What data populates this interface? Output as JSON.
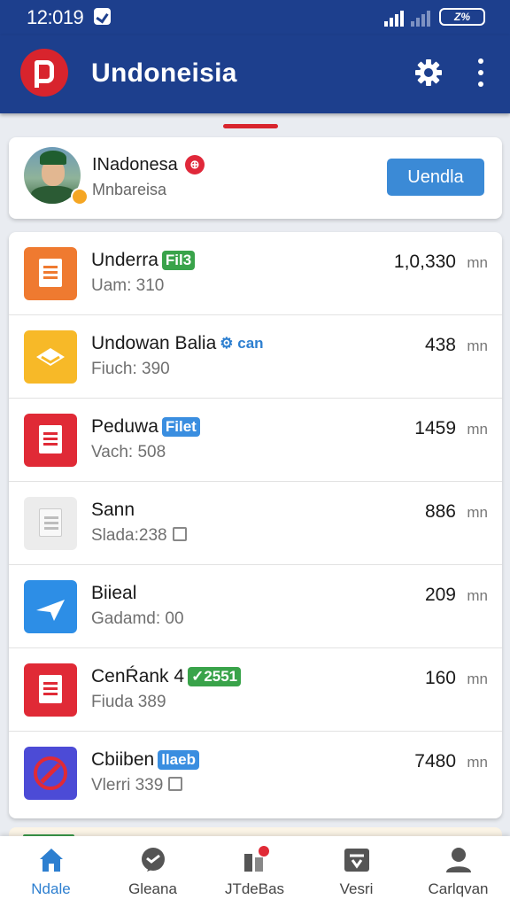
{
  "status": {
    "time": "12:019",
    "battery": "Z%"
  },
  "appbar": {
    "title": "Undoneisia",
    "settings_icon": "gear-icon",
    "more_icon": "more-vert-icon"
  },
  "profile": {
    "name": "INadonesa",
    "flag_glyph": "⊕",
    "subtitle": "Mnbareisa",
    "button": "Uendla"
  },
  "list": [
    {
      "title": "Underra",
      "badge": "Fil3",
      "badge_style": "green",
      "sub": "Uam: 310",
      "value": "1,0,330",
      "unit": "mn",
      "icon_color": "#ef7a30",
      "icon": "note-icon"
    },
    {
      "title": "Undowan Balia",
      "badge": "can",
      "badge_style": "text-blue",
      "sub": "Fiuch: 390",
      "value": "438",
      "unit": "mn",
      "icon_color": "#f7b928",
      "icon": "envelope-icon"
    },
    {
      "title": "Peduwa",
      "badge": "Filet",
      "badge_style": "blue",
      "sub": "Vach: 508",
      "value": "1459",
      "unit": "mn",
      "icon_color": "#e02a36",
      "icon": "document-icon"
    },
    {
      "title": "Sann",
      "badge": "",
      "badge_style": "",
      "sub": "Slada:238",
      "value": "886",
      "unit": "mn",
      "icon_color": "#e8e8e8",
      "icon": "file-icon"
    },
    {
      "title": "Biieal",
      "badge": "",
      "badge_style": "",
      "sub": "Gadamd: 00",
      "value": "209",
      "unit": "mn",
      "icon_color": "#2d8ee6",
      "icon": "send-icon"
    },
    {
      "title": "CenŔank 4",
      "badge": "2551",
      "badge_style": "green",
      "sub": "Fiuda 389",
      "value": "160",
      "unit": "mn",
      "icon_color": "#e02a36",
      "icon": "document-icon"
    },
    {
      "title": "Cbiiben",
      "badge": "llaeb",
      "badge_style": "blue",
      "sub": "Vlerri 339",
      "value": "7480",
      "unit": "mn",
      "icon_color": "#4c4bd6",
      "icon": "compass-icon"
    }
  ],
  "nav": [
    {
      "label": "Ndale",
      "icon": "home-icon",
      "active": true
    },
    {
      "label": "Gleana",
      "icon": "chat-icon",
      "active": false
    },
    {
      "label": "JTdeBas",
      "icon": "stats-icon",
      "active": false
    },
    {
      "label": "Vesri",
      "icon": "inbox-icon",
      "active": false
    },
    {
      "label": "Carlqvan",
      "icon": "person-icon",
      "active": false
    }
  ]
}
